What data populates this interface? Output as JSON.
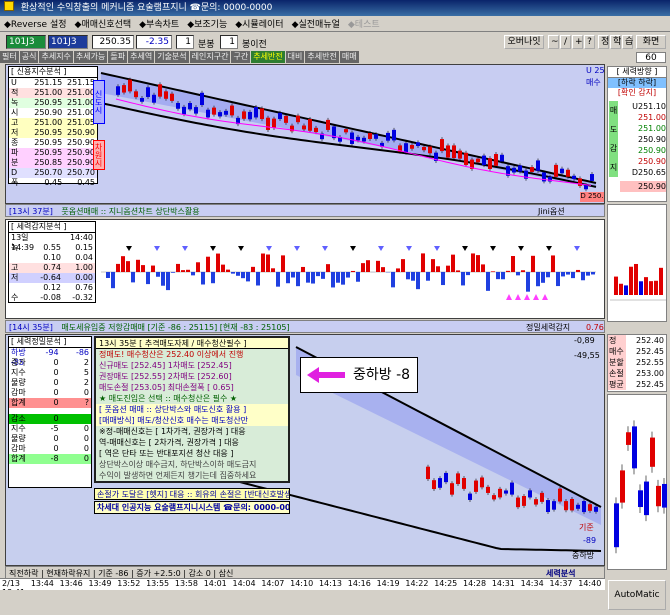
{
  "window": {
    "title": "환상적인 수익창출의 메커니즘 요술램프지니 ☎문의: 0000-0000"
  },
  "menu": [
    {
      "label": "◆Reverse 설정",
      "dim": false
    },
    {
      "label": "◆매매신호선택",
      "dim": false
    },
    {
      "label": "◆부속차트",
      "dim": false
    },
    {
      "label": "◆보조기능",
      "dim": false
    },
    {
      "label": "◆시뮬레이터",
      "dim": false
    },
    {
      "label": "◆실전매뉴얼",
      "dim": false
    },
    {
      "label": "◆테스트",
      "dim": true
    }
  ],
  "toolbar": {
    "symbol": "101J3",
    "price": "250.35",
    "change": "-2.35",
    "interval_value": "1",
    "interval_unit": "분봉",
    "before_value": "1",
    "before_unit": "봉이전",
    "oversight_label": "오버나잇",
    "tools": [
      "~",
      "/",
      "+",
      "?"
    ],
    "right_labels": [
      "정",
      "학",
      "습"
    ],
    "screen_label": "화면",
    "screen_value": "60"
  },
  "tabs": [
    "필터",
    "공식",
    "추세지수",
    "추세가능",
    "돌파",
    "추세역",
    "기술분석",
    "레인지구간",
    "구간",
    "추세반전",
    "대비",
    "추세반전",
    "매매"
  ],
  "top_chart": {
    "title": "[ 신용지수분석 ]",
    "rows": [
      {
        "k": "U",
        "a": "251.15",
        "b": "251.15"
      },
      {
        "k": "적",
        "a": "251.00",
        "b": "251.00"
      },
      {
        "k": "녹",
        "a": "250.95",
        "b": "251.00"
      },
      {
        "k": "시",
        "a": "250.90",
        "b": "251.00"
      },
      {
        "k": "고",
        "a": "251.00",
        "b": "251.05"
      },
      {
        "k": "저",
        "a": "250.95",
        "b": "250.90"
      },
      {
        "k": "종",
        "a": "250.95",
        "b": "250.90"
      },
      {
        "k": "파",
        "a": "250.95",
        "b": "250.90"
      },
      {
        "k": "분",
        "a": "250.85",
        "b": "250.90"
      },
      {
        "k": "D",
        "a": "250.70",
        "b": "250.70"
      },
      {
        "k": "폭",
        "a": "0.45",
        "b": "0.45"
      }
    ],
    "side_tags": [
      "신도시",
      "차원시"
    ],
    "right_label_1": "U 25",
    "right_label_2": "매수",
    "status_left": "[13시 37분]",
    "status_mid": "풋옵션매매 :: 지니옵션차트 상단박스활용",
    "status_right": "Jini옵션",
    "status_tag_d": "D 250.",
    "axis_label": "101 940"
  },
  "mid_chart": {
    "title": "[ 세력감지분석 ]",
    "time_a": "13일14:39",
    "time_b": "14:40",
    "rows": [
      {
        "k": "녹",
        "a": "0.55",
        "b": "0.15"
      },
      {
        "k": "",
        "a": "0.10",
        "b": "0.04"
      },
      {
        "k": "고",
        "a": "0.74",
        "b": "1.00"
      },
      {
        "k": "저",
        "a": "-0.64",
        "b": "0.00"
      },
      {
        "k": "",
        "a": "0.12",
        "b": "0.76"
      },
      {
        "k": "수",
        "a": "-0.08",
        "b": "-0.32"
      }
    ],
    "status_left": "[14시 35분]",
    "status_mid": "매도세유입중 저항감매매 [기준 -86 : 25115] [현재 -83 : 25105]",
    "status_right": "정밀세력감지",
    "status_val": "0.76"
  },
  "bottom_chart": {
    "title": "[ 세력정밀분석 ]",
    "header": {
      "a": "하방 -85",
      "b": "-94",
      "c": "-86"
    },
    "rows_top": [
      {
        "k": "증가",
        "a": "0",
        "b": "2"
      },
      {
        "k": "지수",
        "a": "0",
        "b": "5"
      },
      {
        "k": "물량",
        "a": "0",
        "b": "2"
      },
      {
        "k": "감마",
        "a": "0",
        "b": "0"
      }
    ],
    "sum1": {
      "k": "합계",
      "a": "0",
      "b": "?"
    },
    "rows_bot": [
      {
        "k": "감소",
        "a": "0",
        "b": ""
      },
      {
        "k": "지수",
        "a": "-5",
        "b": "0"
      },
      {
        "k": "물량",
        "a": "0",
        "b": "0"
      },
      {
        "k": "감마",
        "a": "0",
        "b": "0"
      }
    ],
    "sum2": {
      "k": "합계",
      "a": "-8",
      "b": "0"
    },
    "right_val_1": "-0,89",
    "right_val_2": "-49,55",
    "right_tag_1": "기준",
    "right_tag_2": "-89",
    "right_tag_3": "중하방",
    "status_left": "세력",
    "status_right": "세력분석",
    "status_line": "직전하락 | 현재하락유지 | 기준 -86 | 증가 +2.5:0 | 감소 0 | 삼신"
  },
  "popup": {
    "title": "13시 35분 [ 추격매도자제 / 매수청산필수 ]",
    "lines": [
      {
        "t": "정매도! 매수청산은 252.40 이상에서 진행",
        "c": "#c00000"
      },
      {
        "t": "신규매도 [252.45]        1차매도 [252.45]",
        "c": "#800080"
      },
      {
        "t": "권장매도 [252.55]        2차매도 [252.60]",
        "c": "#800080"
      },
      {
        "t": "매도손절 [253.05]        최대손절폭 [ 0.65]",
        "c": "#800080"
      },
      {
        "t": "★ 매도진입은 선택  ::  매수청산은 필수 ★",
        "c": "#006000"
      },
      {
        "t": "[ 풋옵션 매매 :: 상단박스와 매도신호 활용 ]",
        "c": "#0000c0"
      },
      {
        "t": "[매매방식] 매도/청산신호 매수는 매도청산만",
        "c": "#0000c0"
      },
      {
        "t": "※정-매매신호는 [ 1차가격, 권장가격 ] 대응",
        "c": "#000000"
      },
      {
        "t": "  역-매매신호는 [ 2차가격, 권장가격 ] 대응",
        "c": "#000000"
      },
      {
        "t": "[ 역은 단타 또는 반대포지션 청산 대응 ]",
        "c": "#000000"
      },
      {
        "t": "상단박스이상 매수금지, 하단박스이하 매도금지",
        "c": "#404040"
      },
      {
        "t": "수익이 발생하면 언제든지 챙기는데 집중하세요",
        "c": "#404040"
      }
    ],
    "bottom_line_1": "손절가 도달은 [헷지] 대응 :: 회유의 손절은 [반대신호발생]",
    "bottom_line_2": "차세대 인공지능 요술램프지니시스템 ☎문의: 0000-0000"
  },
  "annotation": {
    "label": "중하방 -8"
  },
  "right_panel": {
    "title": "[ 세력방향 ]",
    "sub1": "[하락 하락]",
    "sub2": "[확인 감지]",
    "vertical_tags": [
      "매",
      "도",
      "감",
      "지"
    ],
    "values": [
      {
        "v": "U251.10",
        "c": "#000000"
      },
      {
        "v": "251.00",
        "c": "#c00000"
      },
      {
        "v": "251.00",
        "c": "#008000"
      },
      {
        "v": "250.90",
        "c": "#000000"
      },
      {
        "v": "250.90",
        "c": "#008000"
      },
      {
        "v": "250.90",
        "c": "#c00000"
      },
      {
        "v": "D250.65",
        "c": "#000000"
      }
    ],
    "tag_val": "250.90",
    "bottom_values": [
      {
        "k": "정",
        "v": "252.40"
      },
      {
        "k": "매수",
        "v": "252.45"
      },
      {
        "k": "분할",
        "v": "252.55"
      },
      {
        "k": "손절",
        "v": "253.00"
      },
      {
        "k": "평균",
        "v": "252.45"
      }
    ]
  },
  "time_axis": [
    "2/13 13:41",
    "13:44",
    "13:46",
    "13:49",
    "13:52",
    "13:55",
    "13:58",
    "14:01",
    "14:04",
    "14:07",
    "14:10",
    "14:13",
    "14:16",
    "14:19",
    "14:22",
    "14:25",
    "14:28",
    "14:31",
    "14:34",
    "14:37",
    "14:40"
  ],
  "bottom_bar": {
    "automatic_label": "AutoMatic"
  }
}
